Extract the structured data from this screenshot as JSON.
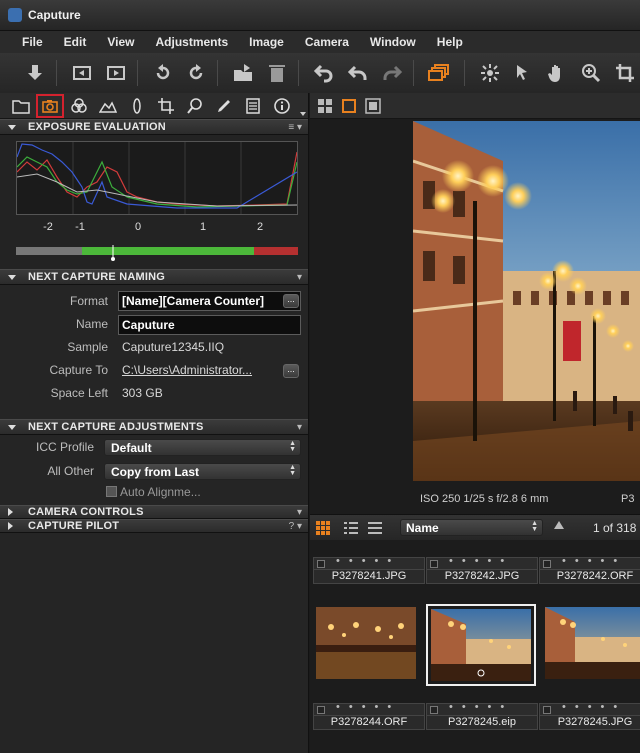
{
  "window": {
    "title": "Caputure"
  },
  "menu": [
    "File",
    "Edit",
    "View",
    "Adjustments",
    "Image",
    "Camera",
    "Window",
    "Help"
  ],
  "toolbar": {
    "icons": [
      "import-icon",
      "previous-icon",
      "next-icon",
      "rotate-left-icon",
      "rotate-right-icon",
      "move-to-folder-icon",
      "trash-icon",
      "undo-icon",
      "undo-step-icon",
      "redo-icon",
      "layers-icon",
      "sun-icon",
      "select-icon",
      "pan-icon",
      "zoom-icon",
      "crop-icon"
    ]
  },
  "tool_tabs": {
    "icons": [
      "library-icon",
      "camera-icon",
      "color-icon",
      "exposure-icon",
      "lens-icon",
      "crop-icon",
      "focus-icon",
      "adjustments-icon",
      "metadata-icon",
      "info-icon"
    ],
    "active_index": 1
  },
  "exposure": {
    "title": "EXPOSURE EVALUATION",
    "ticks": [
      "-2",
      "-1",
      "0",
      "1",
      "2"
    ]
  },
  "naming": {
    "title": "NEXT CAPTURE NAMING",
    "format_label": "Format",
    "format_value": "[Name][Camera Counter]",
    "name_label": "Name",
    "name_value": "Caputure",
    "sample_label": "Sample",
    "sample_value": "Caputure12345.IIQ",
    "capture_to_label": "Capture To",
    "capture_to_value": "C:\\Users\\Administrator...",
    "space_left_label": "Space Left",
    "space_left_value": "303 GB",
    "dots_label": "..."
  },
  "adjustments": {
    "title": "NEXT CAPTURE ADJUSTMENTS",
    "icc_label": "ICC Profile",
    "icc_value": "Default",
    "all_other_label": "All Other",
    "all_other_value": "Copy from Last",
    "auto_align_label": "Auto Alignme..."
  },
  "collapsed_sections": [
    "CAMERA CONTROLS",
    "CAPTURE PILOT"
  ],
  "capture_pilot_help": "?",
  "viewer": {
    "meta": "ISO 250  1/25 s  f/2.8  6 mm",
    "filename_partial": "P3"
  },
  "browser": {
    "sort_value": "Name",
    "page_count": "1 of 318",
    "row1": [
      "P3278241.JPG",
      "P3278242.JPG",
      "P3278242.ORF"
    ],
    "row2": [
      "P3278244.ORF",
      "P3278245.eip",
      "P3278245.JPG"
    ],
    "selected_index": 1
  }
}
